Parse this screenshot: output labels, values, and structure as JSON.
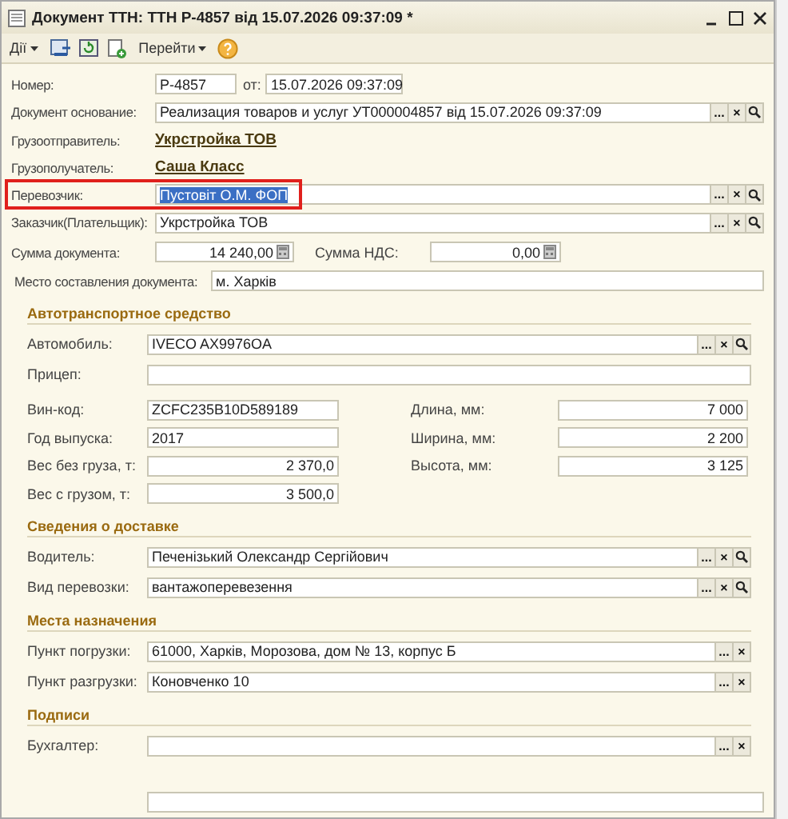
{
  "window": {
    "title": "Документ ТТН: ТТН Р-4857 від 15.07.2026 09:37:09 *"
  },
  "toolbar": [
    {
      "kind": "menu",
      "label": "Дії"
    },
    {
      "kind": "save"
    },
    {
      "kind": "refresh"
    },
    {
      "kind": "copy"
    },
    {
      "kind": "menu",
      "label": "Перейти"
    },
    {
      "kind": "help"
    }
  ],
  "header": [
    {
      "kind": "number",
      "label": "Номер:",
      "value": "Р-4857",
      "date_label": "от:",
      "date": "15.07.2026 09:37:09"
    },
    {
      "kind": "ref",
      "label": "Документ основание:",
      "value": "Реализация товаров и услуг УТ000004857 від 15.07.2026 09:37:09",
      "buttons": [
        "...",
        "×"
      ],
      "search": true,
      "selected": false,
      "highlighted": false
    },
    {
      "kind": "link",
      "label": "Грузоотправитель:",
      "value": "Укрстройка ТОВ"
    },
    {
      "kind": "link",
      "label": "Грузополучатель:",
      "value": "Саша Класс"
    },
    {
      "kind": "ref",
      "label": "Перевозчик:",
      "value": "Пустовіт О.М. ФОП",
      "buttons": [
        "...",
        "×"
      ],
      "search": true,
      "selected": true,
      "highlighted": true
    },
    {
      "kind": "ref",
      "label": "Заказчик(Плательщик):",
      "value": "Укрстройка ТОВ",
      "buttons": [
        "...",
        "×"
      ],
      "search": true,
      "selected": false,
      "highlighted": false
    },
    {
      "kind": "sums",
      "label": "Сумма документа:",
      "value": "14 240,00",
      "label2": "Сумма НДС:",
      "value2": "0,00"
    },
    {
      "kind": "text",
      "label": "Место составления документа:",
      "value": "м. Харків"
    }
  ],
  "sections": [
    {
      "title": "Автотранспортное средство",
      "rows": [
        {
          "kind": "ref",
          "label": "Автомобиль:",
          "value": "IVECO AX9976OA",
          "buttons": [
            "...",
            "×"
          ],
          "search": true
        },
        {
          "kind": "plain",
          "label": "Прицеп:"
        },
        {
          "kind": "grid",
          "left": [
            {
              "label": "Вин-код:",
              "value": "ZCFC235B10D589189",
              "numeric": false
            },
            {
              "label": "Год выпуска:",
              "value": "2017",
              "numeric": false
            },
            {
              "label": "Вес без груза, т:",
              "value": "2 370,0",
              "numeric": true
            },
            {
              "label": "Вес с грузом, т:",
              "value": "3 500,0",
              "numeric": true
            }
          ],
          "right": [
            {
              "label": "Длина, мм:",
              "value": "7 000",
              "numeric": true
            },
            {
              "label": "Ширина, мм:",
              "value": "2 200",
              "numeric": true
            },
            {
              "label": "Высота, мм:",
              "value": "3 125",
              "numeric": true
            }
          ]
        }
      ]
    },
    {
      "title": "Сведения о доставке",
      "rows": [
        {
          "kind": "ref",
          "label": "Водитель:",
          "value": "Печенізький Олександр Сергійович",
          "buttons": [
            "...",
            "×"
          ],
          "search": true
        },
        {
          "kind": "ref",
          "label": "Вид перевозки:",
          "value": "вантажоперевезення",
          "buttons": [
            "...",
            "×"
          ],
          "search": true
        }
      ]
    },
    {
      "title": "Места назначения",
      "rows": [
        {
          "kind": "ref",
          "label": "Пункт погрузки:",
          "value": "61000, Харків, Морозова, дом № 13, корпус Б",
          "buttons": [
            "...",
            "×"
          ],
          "search": false
        },
        {
          "kind": "ref",
          "label": "Пункт разгрузки:",
          "value": "Коновченко 10",
          "buttons": [
            "...",
            "×"
          ],
          "search": false
        }
      ]
    },
    {
      "title": "Подписи",
      "rows": [
        {
          "kind": "ref",
          "label": "Бухгалтер:",
          "buttons": [
            "...",
            "×"
          ],
          "search": false
        }
      ]
    }
  ]
}
